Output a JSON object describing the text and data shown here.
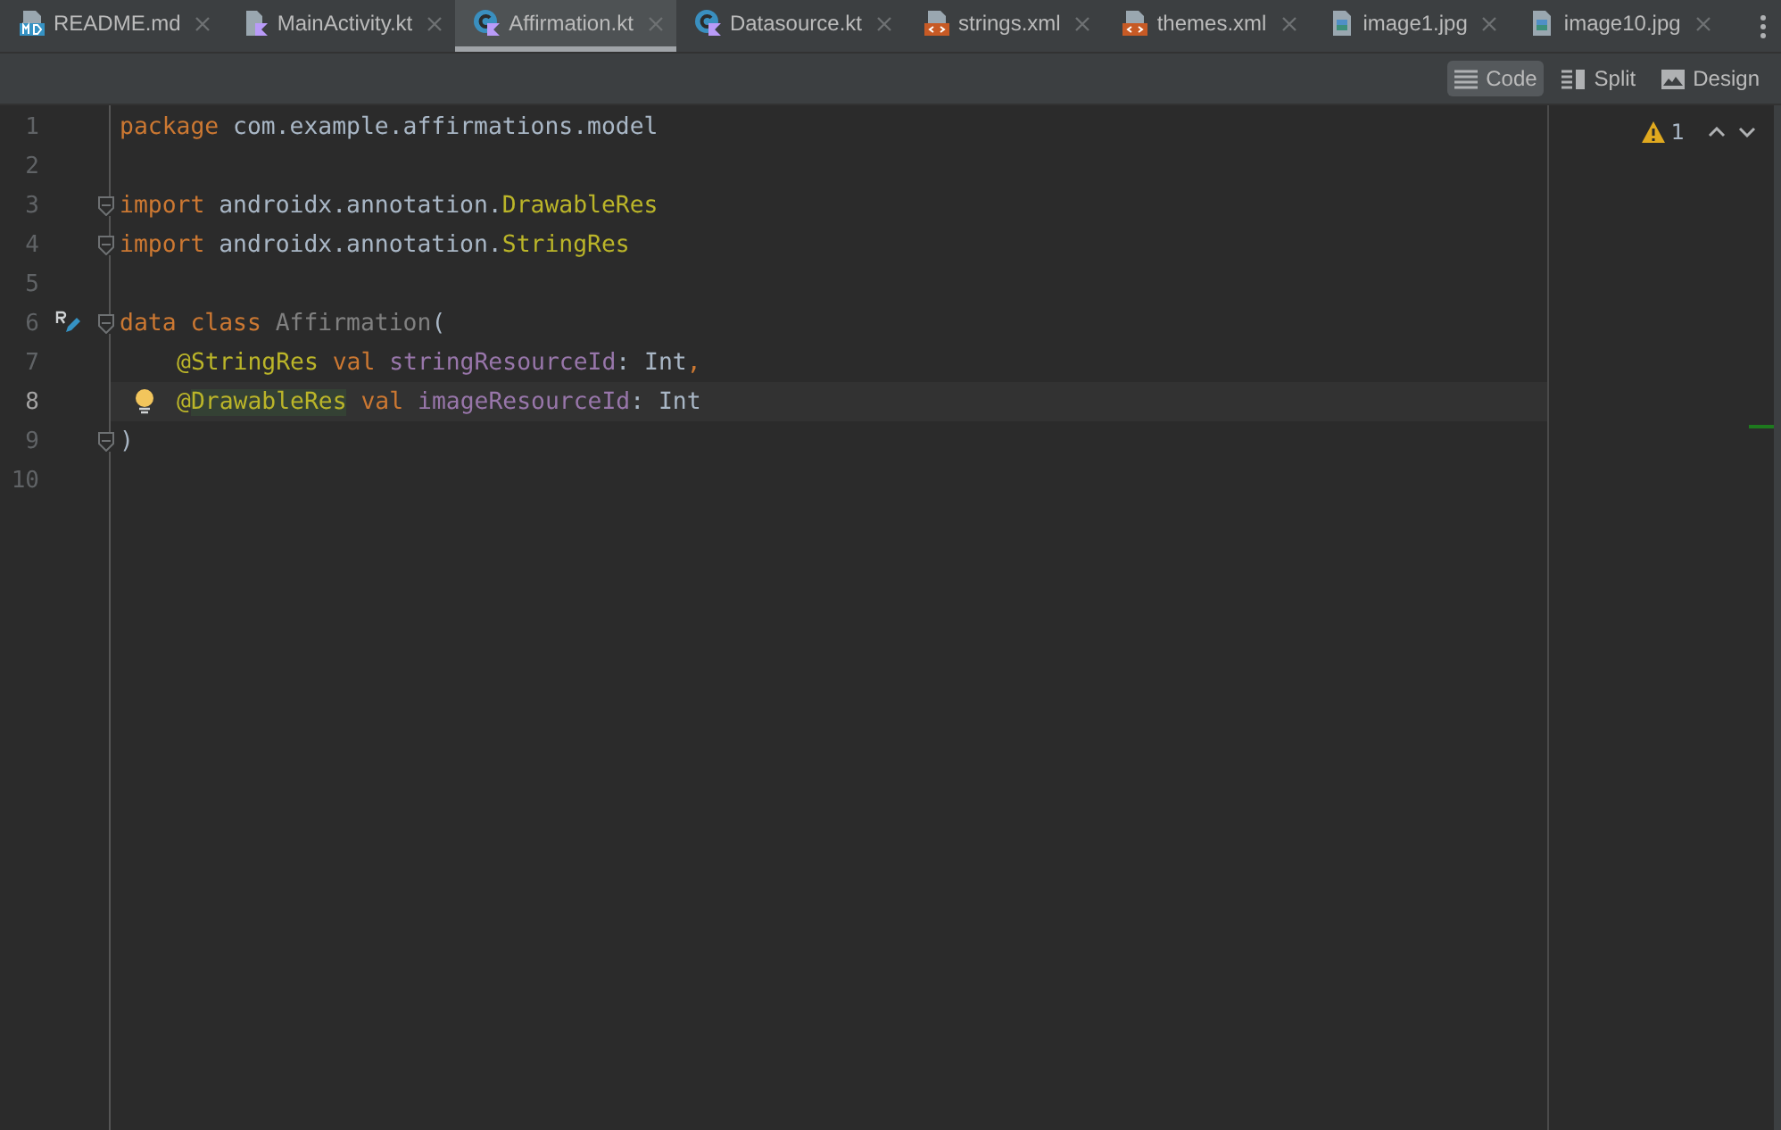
{
  "tabs": [
    {
      "label": "README.md",
      "kind": "markdown",
      "selected": false
    },
    {
      "label": "MainActivity.kt",
      "kind": "kotlin",
      "selected": false
    },
    {
      "label": "Affirmation.kt",
      "kind": "class",
      "selected": true
    },
    {
      "label": "Datasource.kt",
      "kind": "class",
      "selected": false
    },
    {
      "label": "strings.xml",
      "kind": "xml",
      "selected": false
    },
    {
      "label": "themes.xml",
      "kind": "xml",
      "selected": false
    },
    {
      "label": "image1.jpg",
      "kind": "image",
      "selected": false
    },
    {
      "label": "image10.jpg",
      "kind": "image",
      "selected": false
    }
  ],
  "view_modes": [
    {
      "label": "Code",
      "kind": "code",
      "selected": true
    },
    {
      "label": "Split",
      "kind": "split",
      "selected": false
    },
    {
      "label": "Design",
      "kind": "design",
      "selected": false
    }
  ],
  "inspection": {
    "warnings": "1"
  },
  "lines": [
    {
      "number": "1",
      "tokens": [
        {
          "text": "package ",
          "kind": "keyword"
        },
        {
          "text": "com.example.affirmations.model",
          "kind": "ident"
        }
      ]
    },
    {
      "number": "2"
    },
    {
      "number": "3",
      "fold": true,
      "tokens": [
        {
          "text": "import ",
          "kind": "keyword"
        },
        {
          "text": "androidx.annotation.",
          "kind": "ident"
        },
        {
          "text": "DrawableRes",
          "kind": "annotation"
        }
      ]
    },
    {
      "number": "4",
      "fold": true,
      "tokens": [
        {
          "text": "import ",
          "kind": "keyword"
        },
        {
          "text": "androidx.annotation.",
          "kind": "ident"
        },
        {
          "text": "StringRes",
          "kind": "annotation"
        }
      ]
    },
    {
      "number": "5"
    },
    {
      "number": "6",
      "fold": true,
      "resource_marker": true,
      "tokens": [
        {
          "text": "data class ",
          "kind": "keyword"
        },
        {
          "text": "Affirmation",
          "kind": "unused"
        },
        {
          "text": "(",
          "kind": "ident"
        }
      ]
    },
    {
      "number": "7",
      "indented": true,
      "tokens": [
        {
          "text": "@StringRes ",
          "kind": "annotation"
        },
        {
          "text": "val ",
          "kind": "keyword"
        },
        {
          "text": "stringResourceId",
          "kind": "property"
        },
        {
          "text": ": Int",
          "kind": "ident"
        },
        {
          "text": ",",
          "kind": "keyword"
        }
      ]
    },
    {
      "number": "8",
      "indented": true,
      "current": true,
      "bulb": true,
      "tokens": [
        {
          "text": "@",
          "kind": "annotation"
        },
        {
          "text": "DrawableRes",
          "kind": "annotation",
          "highlight": true
        },
        {
          "text": " val ",
          "kind": "keyword"
        },
        {
          "text": "imageResourceId",
          "kind": "property"
        },
        {
          "text": ": Int",
          "kind": "ident"
        }
      ]
    },
    {
      "number": "9",
      "fold": true,
      "tokens": [
        {
          "text": ")",
          "kind": "ident"
        }
      ]
    },
    {
      "number": "10"
    }
  ]
}
